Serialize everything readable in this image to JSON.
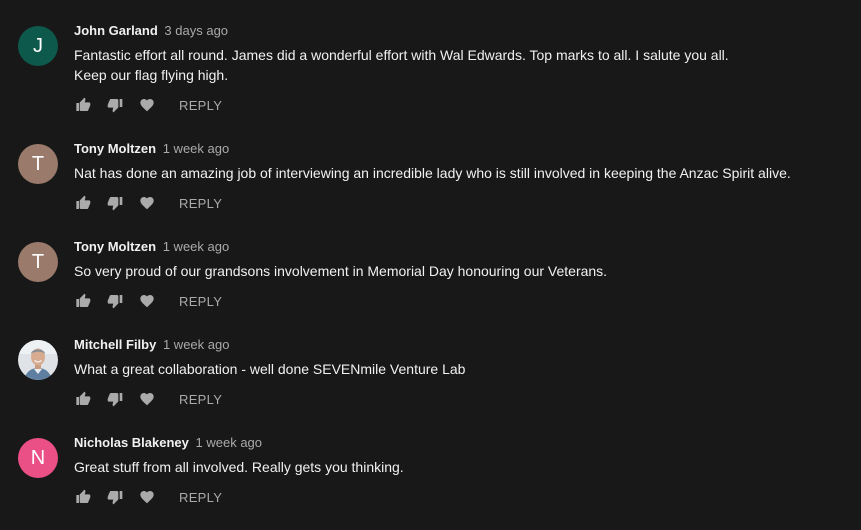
{
  "comments": [
    {
      "author": "John Garland",
      "time": "3 days ago",
      "text": "Fantastic effort all round. James did a wonderful effort with Wal Edwards. Top marks to all. I salute you all.\nKeep our flag flying high.",
      "avatar_letter": "J",
      "avatar_color": "#0d5a4c",
      "avatar_type": "letter",
      "reply_label": "REPLY"
    },
    {
      "author": "Tony Moltzen",
      "time": "1 week ago",
      "text": "Nat has done an amazing job of interviewing an incredible lady who is still involved in keeping the Anzac Spirit alive.",
      "avatar_letter": "T",
      "avatar_color": "#9a7a6a",
      "avatar_type": "letter",
      "reply_label": "REPLY"
    },
    {
      "author": "Tony Moltzen",
      "time": "1 week ago",
      "text": "So very proud of our grandsons involvement in Memorial Day honouring our Veterans.",
      "avatar_letter": "T",
      "avatar_color": "#9a7a6a",
      "avatar_type": "letter",
      "reply_label": "REPLY"
    },
    {
      "author": "Mitchell Filby",
      "time": "1 week ago",
      "text": "What a great collaboration - well done SEVENmile Venture Lab",
      "avatar_letter": "",
      "avatar_color": "#d9dde2",
      "avatar_type": "photo",
      "reply_label": "REPLY"
    },
    {
      "author": "Nicholas Blakeney",
      "time": "1 week ago",
      "text": "Great stuff from all involved. Really gets you thinking.",
      "avatar_letter": "N",
      "avatar_color": "#ea4f86",
      "avatar_type": "letter",
      "reply_label": "REPLY"
    }
  ],
  "icons": {
    "like": "thumbs-up-icon",
    "dislike": "thumbs-down-icon",
    "heart": "heart-icon"
  },
  "colors": {
    "background": "#181818",
    "text_primary": "#f1f1f1",
    "text_secondary": "#aaaaaa",
    "icon": "#aaaaaa"
  }
}
